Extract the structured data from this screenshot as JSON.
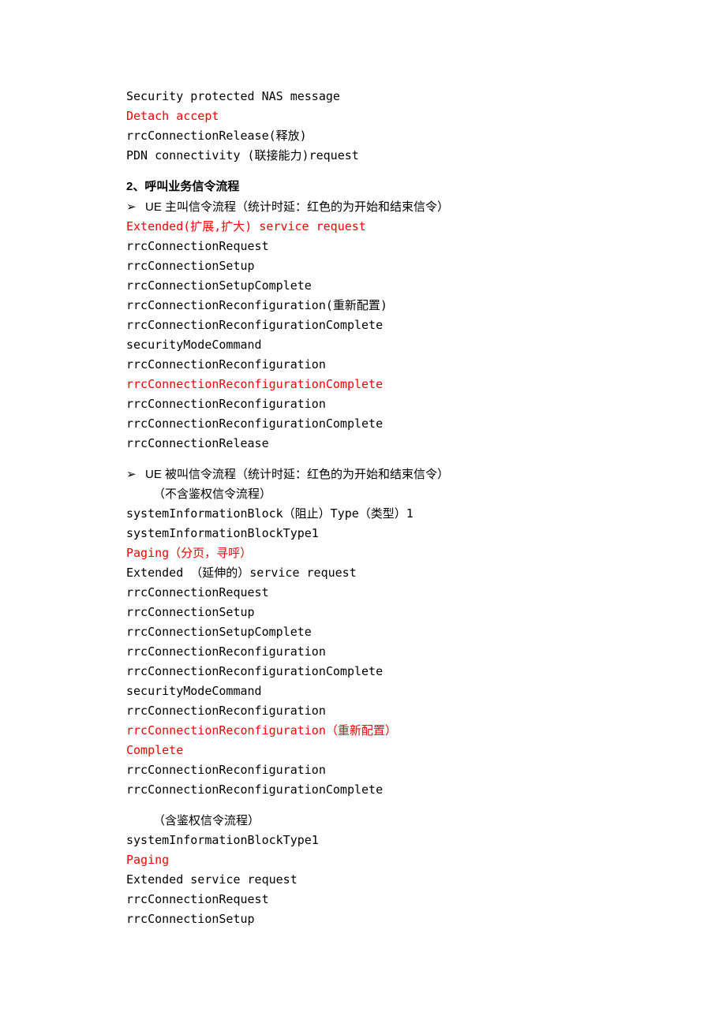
{
  "top": {
    "l1": "Security protected NAS message",
    "l2": "Detach accept",
    "l3": "rrcConnectionRelease(释放)",
    "l4": "PDN connectivity (联接能力)request"
  },
  "section2": {
    "heading": "2、呼叫业务信令流程",
    "bullet1_prefix": "UE ",
    "bullet1_rest": "主叫信令流程（统计时延：红色的为开始和结束信令）",
    "group1": {
      "l1": "Extended(扩展,扩大) service request",
      "l2": "rrcConnectionRequest",
      "l3": "rrcConnectionSetup",
      "l4": "rrcConnectionSetupComplete",
      "l5": "rrcConnectionReconfiguration(重新配置)",
      "l6": "rrcConnectionReconfigurationComplete",
      "l7": "securityModeCommand",
      "l8": "rrcConnectionReconfiguration",
      "l9": "rrcConnectionReconfigurationComplete",
      "l10": "rrcConnectionReconfiguration",
      "l11": "rrcConnectionReconfigurationComplete",
      "l12": "rrcConnectionRelease"
    },
    "bullet2_prefix": "UE ",
    "bullet2_rest": "被叫信令流程（统计时延：红色的为开始和结束信令）",
    "bullet2_sub": "（不含鉴权信令流程）",
    "group2": {
      "l1": "systemInformationBlock（阻止）Type（类型）1",
      "l2": "systemInformationBlockType1",
      "l3": "Paging（分页，寻呼）",
      "l4": "Extended （延伸的）service request",
      "l5": "rrcConnectionRequest",
      "l6": "rrcConnectionSetup",
      "l7": "rrcConnectionSetupComplete",
      "l8": "rrcConnectionReconfiguration",
      "l9": "rrcConnectionReconfigurationComplete",
      "l10": "securityModeCommand",
      "l11": "rrcConnectionReconfiguration",
      "l12": "rrcConnectionReconfiguration（重新配置）",
      "l13": "Complete",
      "l14": "rrcConnectionReconfiguration",
      "l15": "rrcConnectionReconfigurationComplete"
    },
    "sub3": "（含鉴权信令流程）",
    "group3": {
      "l1": "systemInformationBlockType1",
      "l2": "Paging",
      "l3": "Extended service request",
      "l4": "rrcConnectionRequest",
      "l5": "rrcConnectionSetup"
    }
  },
  "glyphs": {
    "arrow": "➢"
  }
}
